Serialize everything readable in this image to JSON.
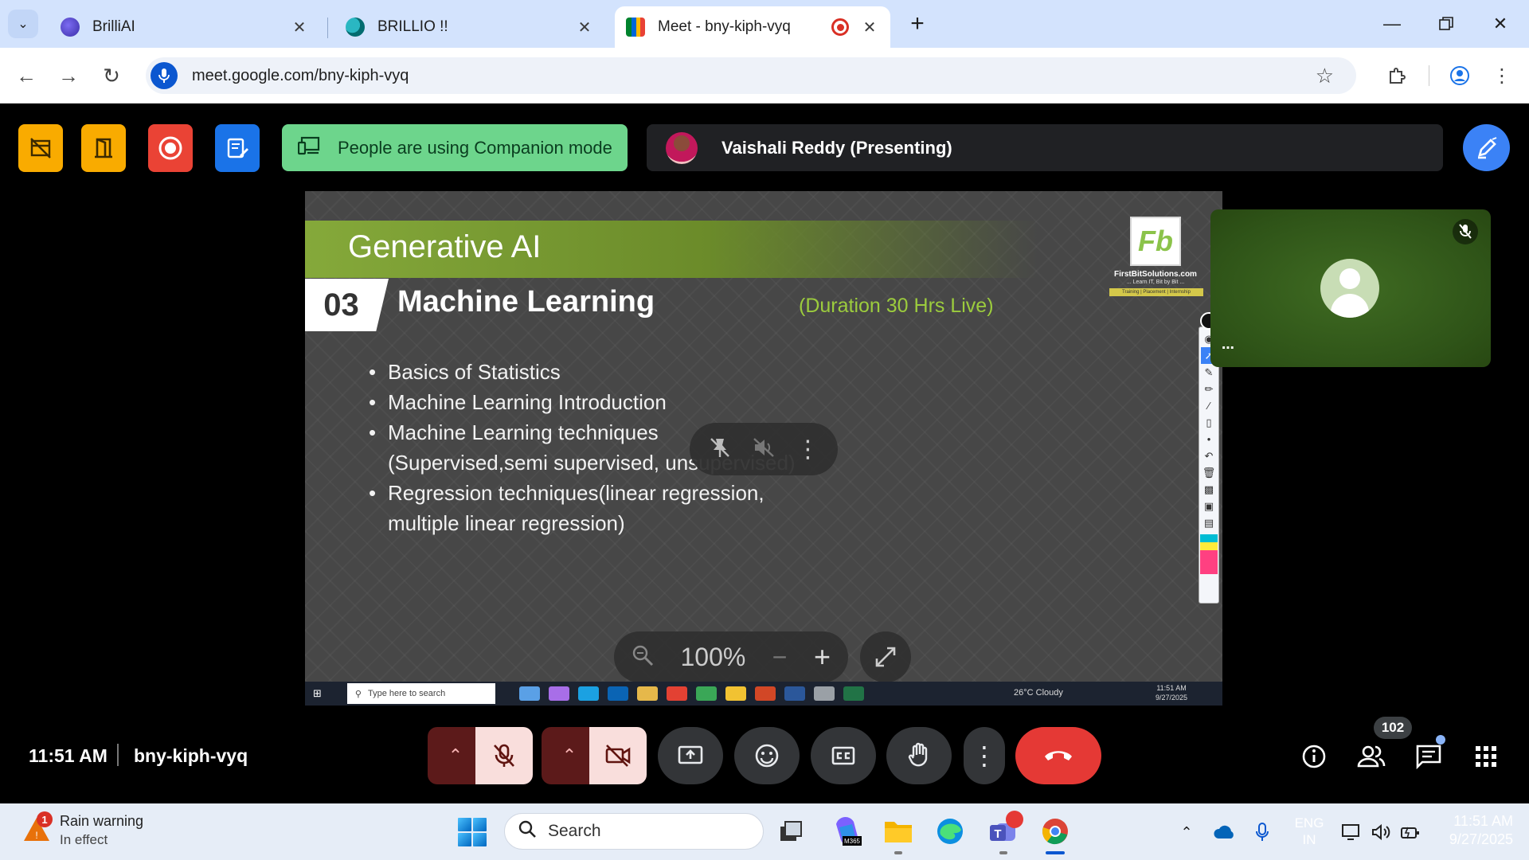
{
  "browser": {
    "tabs": [
      {
        "label": "BrilliAI",
        "favicon": "brilliai-icon",
        "active": false
      },
      {
        "label": "BRILLIO !!",
        "favicon": "sharepoint-icon",
        "active": false
      },
      {
        "label": "Meet - bny-kiph-vyq",
        "favicon": "google-meet-icon",
        "active": true,
        "recording": true
      }
    ],
    "url": "meet.google.com/bny-kiph-vyq"
  },
  "meet": {
    "companion_notice": "People are using Companion mode",
    "presenter": "Vaishali Reddy (Presenting)",
    "time": "11:51 AM",
    "meeting_code": "bny-kiph-vyq",
    "participants_count": "102",
    "zoom_level": "100%",
    "colors": {
      "yellow_btn": "#f9ab00",
      "record_btn": "#ea4335",
      "blue_btn": "#1a73e8",
      "companion_bg": "#6dd58c",
      "end_call": "#e53935"
    }
  },
  "slide": {
    "heading": "Generative AI",
    "number": "03",
    "title": "Machine Learning",
    "duration": "(Duration 30 Hrs Live)",
    "bullets": [
      "Basics of Statistics",
      "Machine Learning Introduction",
      "Machine Learning techniques (Supervised,semi supervised, unsupervised)",
      "Regression techniques(linear regression, multiple linear regression)"
    ],
    "logo_letters": "Fb",
    "logo_site": "FirstBitSolutions.com",
    "logo_tagline": "... Learn IT, Bit by Bit ...",
    "logo_strip": "Training | Placement | Internship",
    "inner_taskbar": {
      "search_placeholder": "Type here to search",
      "weather": "26°C  Cloudy",
      "time": "11:51 AM",
      "date": "9/27/2025"
    }
  },
  "taskbar": {
    "weather_title": "Rain warning",
    "weather_sub": "In effect",
    "weather_badge": "1",
    "search_label": "Search",
    "lang_line1": "ENG",
    "lang_line2": "IN",
    "time": "11:51 AM",
    "date": "9/27/2025"
  }
}
